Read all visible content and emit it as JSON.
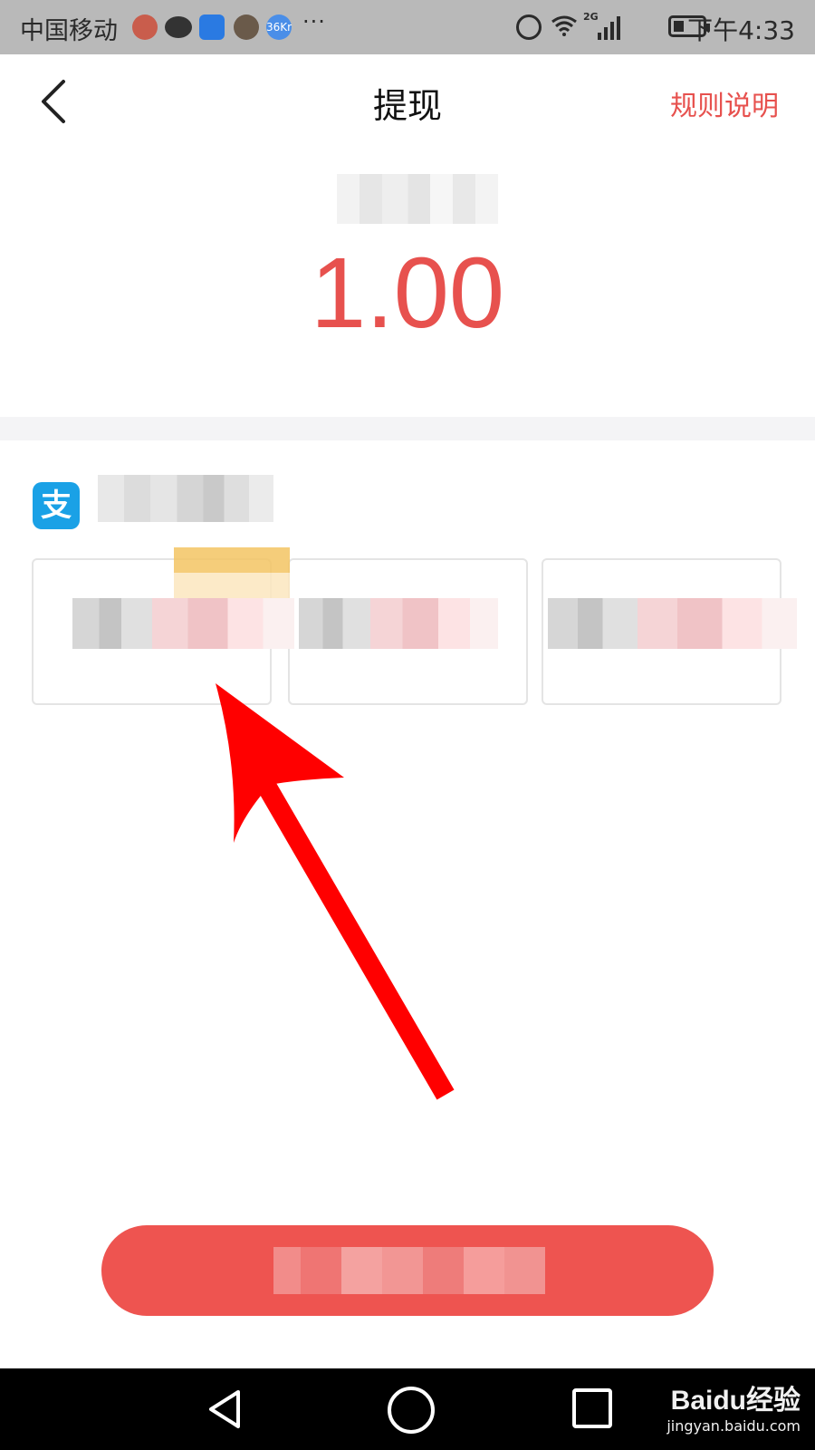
{
  "status_bar": {
    "carrier": "中国移动",
    "network_label": "2G",
    "time": "下午4:33",
    "more_indicator": "···",
    "notification_badge": "36Kr"
  },
  "header": {
    "title": "提现",
    "rules_link": "规则说明",
    "back_icon": "chevron-left-icon"
  },
  "balance": {
    "amount": "1.00"
  },
  "payment": {
    "method_icon": "支"
  },
  "watermark": {
    "brand": "Baidu经验",
    "url": "jingyan.baidu.com"
  },
  "colors": {
    "accent": "#e7514e",
    "button": "#ee5450",
    "alipay": "#1aa1e6",
    "annotation_arrow": "#ff0000"
  }
}
